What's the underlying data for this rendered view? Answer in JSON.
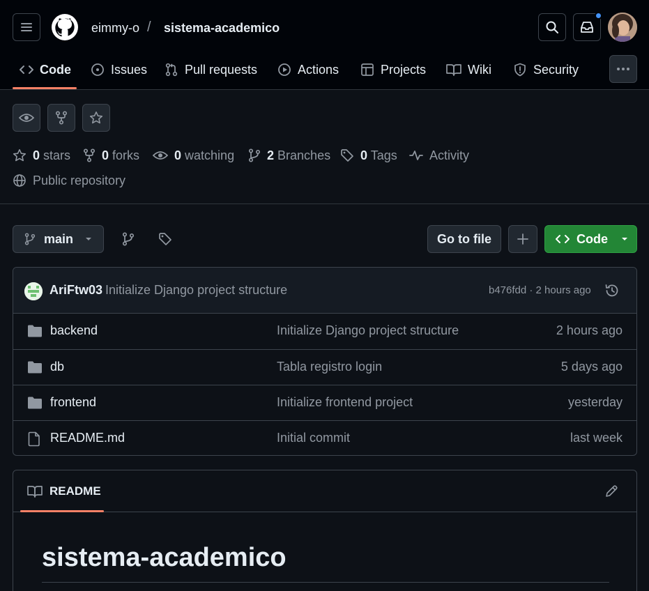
{
  "header": {
    "owner": "eimmy-o",
    "separator": "/",
    "repo": "sistema-academico"
  },
  "nav": {
    "tabs": [
      {
        "label": "Code",
        "icon": "code-icon",
        "active": true
      },
      {
        "label": "Issues",
        "icon": "issue-icon"
      },
      {
        "label": "Pull requests",
        "icon": "pull-request-icon"
      },
      {
        "label": "Actions",
        "icon": "play-icon"
      },
      {
        "label": "Projects",
        "icon": "table-icon"
      },
      {
        "label": "Wiki",
        "icon": "book-icon"
      },
      {
        "label": "Security",
        "icon": "shield-icon"
      }
    ]
  },
  "stats": {
    "stars_count": "0",
    "stars_label": "stars",
    "forks_count": "0",
    "forks_label": "forks",
    "watching_count": "0",
    "watching_label": "watching",
    "branches_count": "2",
    "branches_label": "Branches",
    "tags_count": "0",
    "tags_label": "Tags",
    "activity_label": "Activity",
    "visibility": "Public repository"
  },
  "toolbar": {
    "branch": "main",
    "goto_file": "Go to file",
    "code_button": "Code"
  },
  "commit": {
    "author": "AriFtw03",
    "message": "Initialize Django project structure",
    "meta": "b476fdd · 2 hours ago"
  },
  "files": [
    {
      "name": "backend",
      "type": "folder",
      "message": "Initialize Django project structure",
      "time": "2 hours ago"
    },
    {
      "name": "db",
      "type": "folder",
      "message": "Tabla registro login",
      "time": "5 days ago"
    },
    {
      "name": "frontend",
      "type": "folder",
      "message": "Initialize frontend project",
      "time": "yesterday"
    },
    {
      "name": "README.md",
      "type": "file",
      "message": "Initial commit",
      "time": "last week"
    }
  ],
  "readme": {
    "tab_label": "README",
    "title": "sistema-academico"
  },
  "colors": {
    "background": "#0d1117",
    "header_bg": "#010409",
    "accent_underline": "#f78166",
    "code_button": "#238636",
    "notification_dot": "#4493f8"
  }
}
